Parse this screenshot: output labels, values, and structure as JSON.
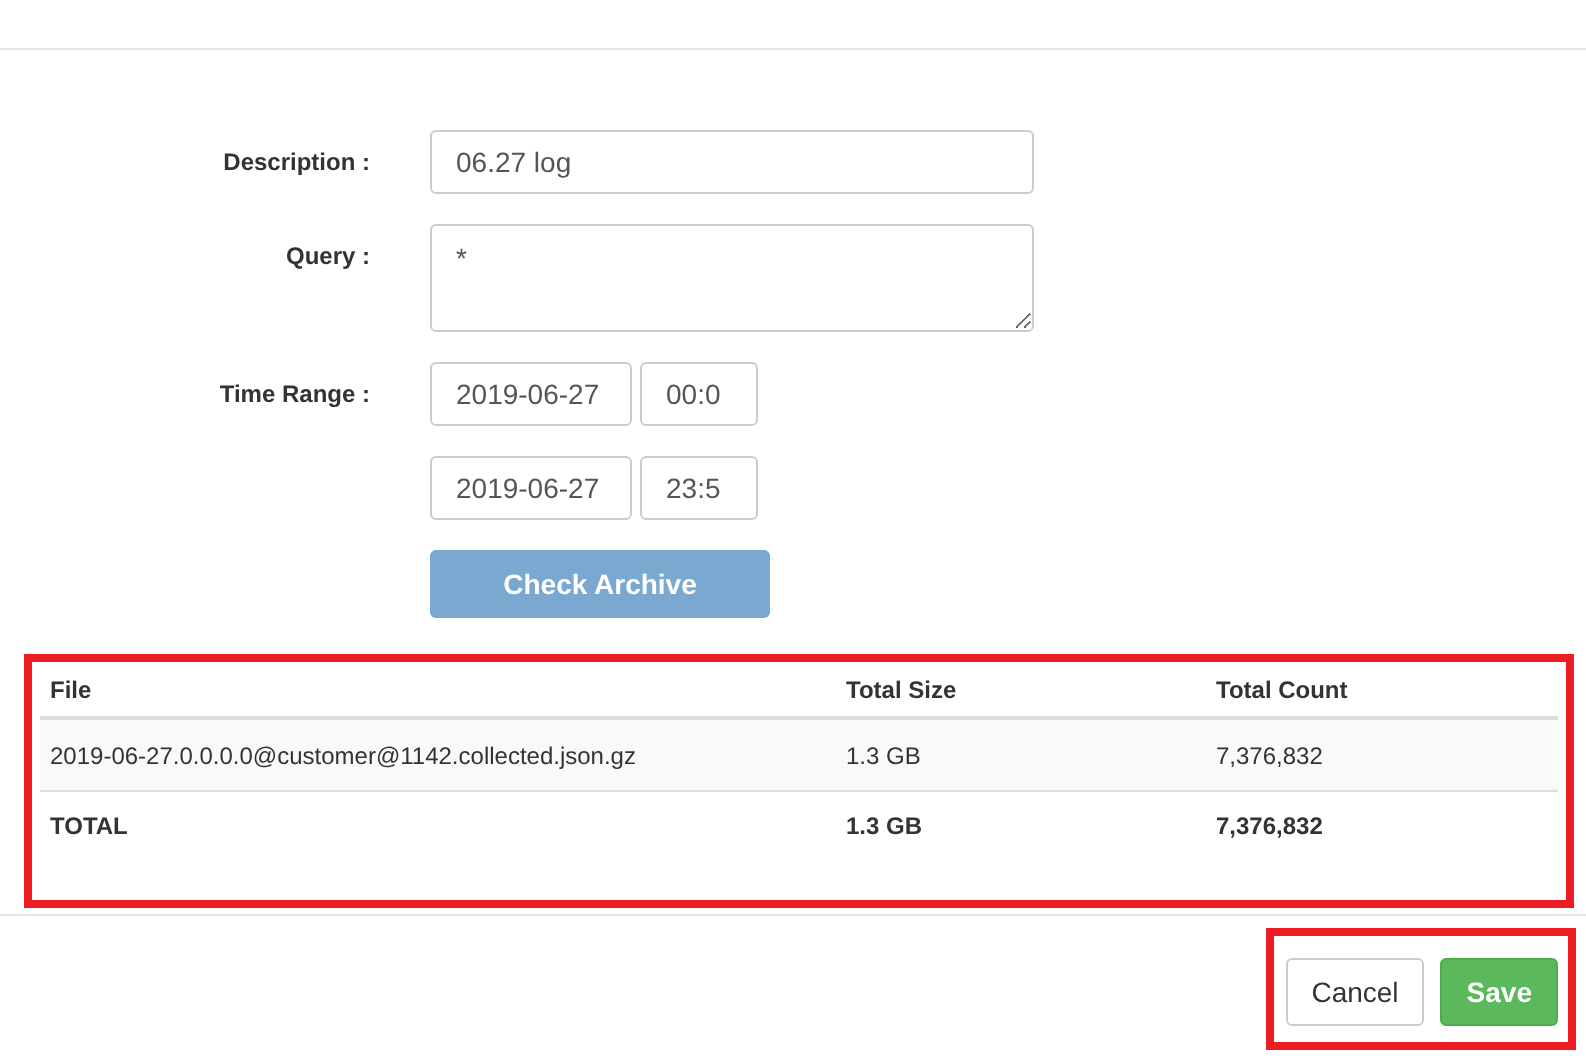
{
  "form": {
    "description": {
      "label": "Description :",
      "value": "06.27 log"
    },
    "query": {
      "label": "Query :",
      "value": "*"
    },
    "time_range": {
      "label": "Time Range :",
      "start_date": "2019-06-27",
      "start_time": "00:0",
      "end_date": "2019-06-27",
      "end_time": "23:5"
    },
    "check_button": "Check Archive"
  },
  "table": {
    "highlighted": true,
    "columns": [
      "File",
      "Total Size",
      "Total Count"
    ],
    "rows": [
      {
        "kind": "item",
        "cells": [
          "2019-06-27.0.0.0.0@customer@1142.collected.json.gz",
          "1.3 GB",
          "7,376,832"
        ]
      },
      {
        "kind": "total",
        "cells": [
          "TOTAL",
          "1.3 GB",
          "7,376,832"
        ]
      }
    ]
  },
  "footer": {
    "highlighted": true,
    "buttons": [
      {
        "label": "Cancel",
        "kind": "default"
      },
      {
        "label": "Save",
        "kind": "primary"
      }
    ]
  }
}
